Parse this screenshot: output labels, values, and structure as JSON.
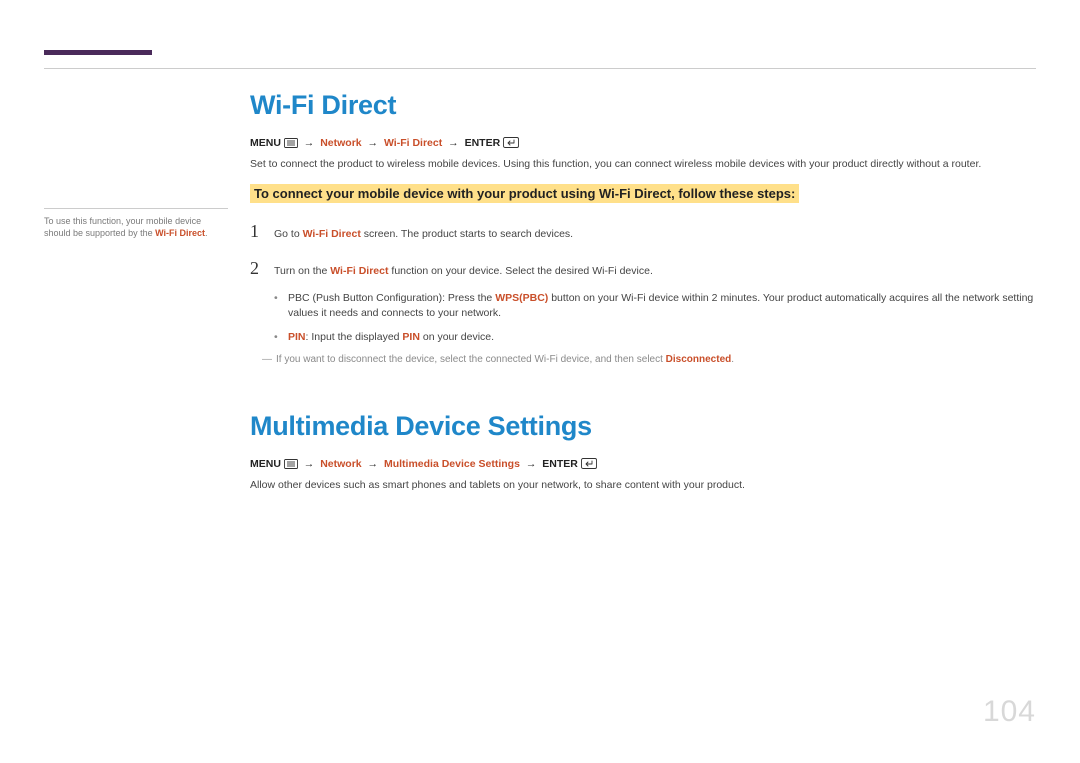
{
  "page_number": "104",
  "sidebar": {
    "note_pre": "To use this function, your mobile device should be supported by the ",
    "note_key": "Wi-Fi Direct",
    "note_post": "."
  },
  "section1": {
    "title": "Wi-Fi Direct",
    "path_menu": "MENU",
    "path_seg1": "Network",
    "path_seg2": "Wi-Fi Direct",
    "path_enter": "ENTER",
    "intro": "Set to connect the product to wireless mobile devices. Using this function, you can connect wireless mobile devices with your product directly without a router.",
    "highlight": "To connect your mobile device with your product using Wi-Fi Direct, follow these steps:",
    "step1_num": "1",
    "step1_a": "Go to ",
    "step1_k": "Wi-Fi Direct",
    "step1_b": " screen. The product starts to search devices.",
    "step2_num": "2",
    "step2_a": "Turn on the ",
    "step2_k": "Wi-Fi Direct",
    "step2_b": " function on your device. Select the desired Wi-Fi device.",
    "bullet1_a": "PBC (Push Button Configuration): Press the ",
    "bullet1_k": "WPS(PBC)",
    "bullet1_b": " button on your Wi-Fi device within 2 minutes. Your product automatically acquires all the network setting values it needs and connects to your network.",
    "bullet2_k1": "PIN",
    "bullet2_a": ": Input the displayed ",
    "bullet2_k2": "PIN",
    "bullet2_b": " on your device.",
    "note_a": "If you want to disconnect the device, select the connected Wi-Fi device, and then select ",
    "note_k": "Disconnected",
    "note_b": "."
  },
  "section2": {
    "title": "Multimedia Device Settings",
    "path_menu": "MENU",
    "path_seg1": "Network",
    "path_seg2": "Multimedia Device Settings",
    "path_enter": "ENTER",
    "body": "Allow other devices such as smart phones and tablets on your network, to share content with your product."
  }
}
